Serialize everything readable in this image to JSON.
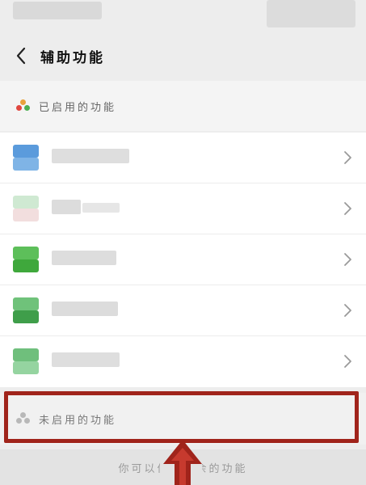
{
  "nav": {
    "back_icon": "chevron-left-icon",
    "title": "辅助功能"
  },
  "enabled_section": {
    "label": "已启用的功能",
    "icon": "three-dots-colored-icon",
    "dot_colors": [
      "#e9a23b",
      "#e0473f",
      "#4caf50"
    ]
  },
  "enabled_items": [
    {
      "icon_top": "#5b9bdc",
      "icon_bottom": "#7fb4e6"
    },
    {
      "icon_top": "#cfe9d2",
      "icon_bottom": "#f2dede"
    },
    {
      "icon_top": "#5dbf5a",
      "icon_bottom": "#3fa83c"
    },
    {
      "icon_top": "#6fc27a",
      "icon_bottom": "#3f9e4a"
    },
    {
      "icon_top": "#6fbf7c",
      "icon_bottom": "#95d4a0"
    }
  ],
  "disabled_section": {
    "label": "未启用的功能",
    "icon": "three-dots-gray-icon",
    "dot_color": "#b8b8b8"
  },
  "footer": {
    "text": "你可以停用其余的功能"
  },
  "annotation": {
    "highlight_color": "#a0241b",
    "arrow_icon": "arrow-up-icon"
  }
}
